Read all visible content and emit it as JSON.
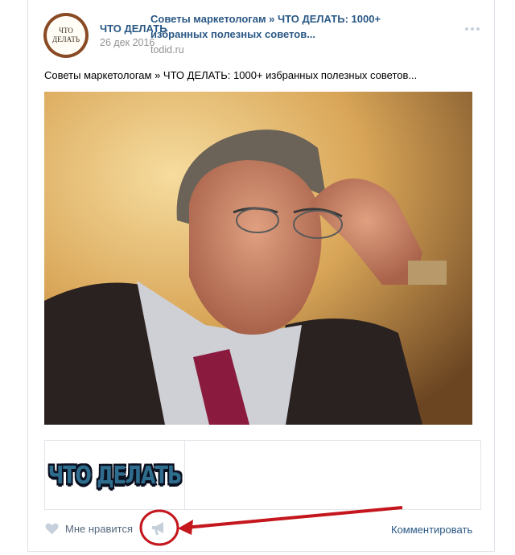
{
  "post": {
    "author": "ЧТО ДЕЛАТЬ",
    "date": "26 дек 2016",
    "avatar_lines": [
      "ЧТО",
      "ДЕЛАТЬ"
    ],
    "text": "Советы маркетологам » ЧТО ДЕЛАТЬ: 1000+ избранных полезных советов..."
  },
  "link": {
    "thumb_text": "ЧТО ДЕЛАТЬ",
    "title": "Советы маркетологам » ЧТО ДЕЛАТЬ: 1000+ избранных полезных советов...",
    "domain": "todid.ru"
  },
  "actions": {
    "like_label": "Мне нравится",
    "comment_label": "Комментировать"
  },
  "icons": {
    "like": "heart-icon",
    "share": "megaphone-icon",
    "more": "more-dots-icon"
  },
  "colors": {
    "link_blue": "#2a5885",
    "annotation_red": "#c4161c",
    "muted": "#939393"
  }
}
